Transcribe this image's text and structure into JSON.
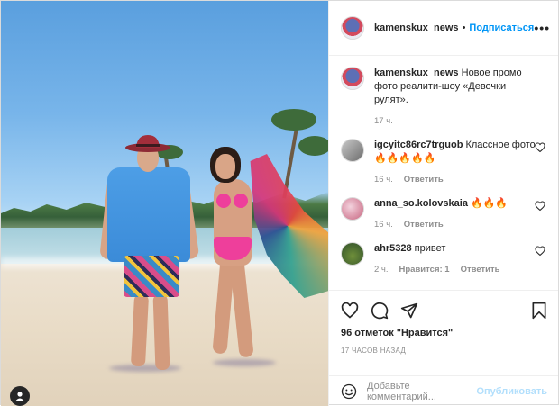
{
  "post": {
    "username": "kamenskux_news",
    "follow_label": "Подписаться",
    "dot": "•",
    "more_label": "•••"
  },
  "caption": {
    "username": "kamenskux_news",
    "text": "Новое промо фото реалити-шоу «Девочки рулят».",
    "time": "17 ч."
  },
  "comments": [
    {
      "username": "igcyitc86rc7trguob",
      "text": "Классное фото 🔥🔥🔥🔥🔥",
      "time": "16 ч.",
      "likes": "",
      "reply": "Ответить"
    },
    {
      "username": "anna_so.kolovskaia",
      "text": "🔥🔥🔥",
      "time": "16 ч.",
      "likes": "",
      "reply": "Ответить"
    },
    {
      "username": "ahr5328",
      "text": "привет",
      "time": "2 ч.",
      "likes": "Нравится: 1",
      "reply": "Ответить"
    }
  ],
  "actions": {
    "likes_text": "96 отметок \"Нравится\"",
    "timestamp": "17 ЧАСОВ НАЗАД"
  },
  "add_comment": {
    "placeholder": "Добавьте комментарий...",
    "post_label": "Опубликовать"
  },
  "icons": {
    "like": "heart-icon",
    "comment": "comment-icon",
    "share": "share-icon",
    "save": "bookmark-icon",
    "emoji": "emoji-icon",
    "user_tag": "user-icon"
  }
}
